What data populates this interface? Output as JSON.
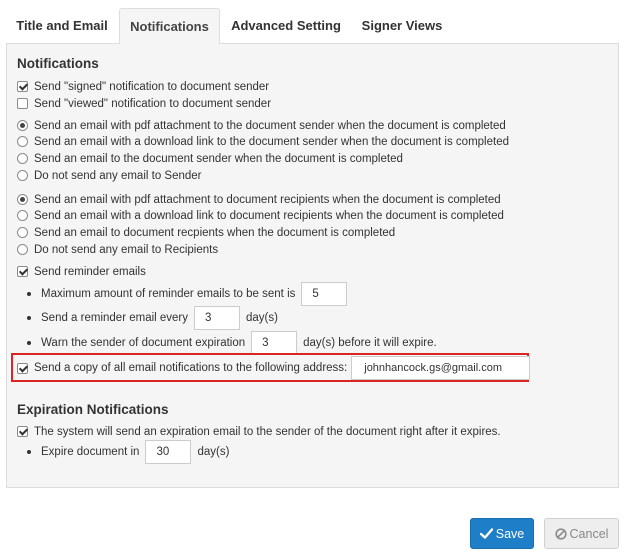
{
  "tabs": [
    {
      "label": "Title and Email"
    },
    {
      "label": "Notifications"
    },
    {
      "label": "Advanced Setting"
    },
    {
      "label": "Signer Views"
    }
  ],
  "active_tab": "Notifications",
  "notifications": {
    "title": "Notifications",
    "signed_label": "Send \"signed\" notification to document sender",
    "signed_checked": true,
    "viewed_label": "Send \"viewed\" notification to document sender",
    "viewed_checked": false,
    "sender_options": [
      {
        "label": "Send an email with pdf attachment to the document sender when the document is completed",
        "selected": true
      },
      {
        "label": "Send an email with a download link to the document sender when the document is completed",
        "selected": false
      },
      {
        "label": "Send an email to the document sender when the document is completed",
        "selected": false
      },
      {
        "label": "Do not send any email to Sender",
        "selected": false
      }
    ],
    "recipient_options": [
      {
        "label": "Send an email with pdf attachment to document recipients when the document is completed",
        "selected": true
      },
      {
        "label": "Send an email with a download link to document recipients when the document is completed",
        "selected": false
      },
      {
        "label": "Send an email to document recpients when the document is completed",
        "selected": false
      },
      {
        "label": "Do not send any email to Recipients",
        "selected": false
      }
    ],
    "reminder": {
      "label": "Send reminder emails",
      "checked": true,
      "max_label": "Maximum amount of reminder emails to be sent is",
      "max_value": "5",
      "every_label": "Send a reminder email every",
      "every_value": "3",
      "every_unit": "day(s)",
      "warn_label": "Warn the sender of document expiration",
      "warn_value": "3",
      "warn_unit": "day(s) before it will expire."
    },
    "copy": {
      "label": "Send a copy of all email notifications to the following address:",
      "checked": true,
      "email": "johnhancock.gs@gmail.com"
    }
  },
  "expiration": {
    "title": "Expiration Notifications",
    "label": "The system will send an expiration email to the sender of the document right after it expires.",
    "checked": true,
    "expire_label": "Expire document in",
    "expire_value": "30",
    "expire_unit": "day(s)"
  },
  "buttons": {
    "save": "Save",
    "cancel": "Cancel"
  },
  "colors": {
    "save_bg": "#1e7ec8",
    "highlight_border": "#dd2424"
  }
}
